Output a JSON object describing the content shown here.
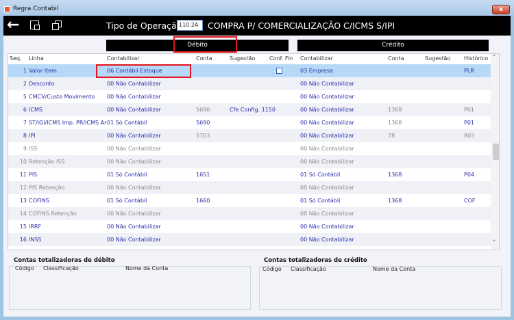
{
  "window": {
    "title": "Regra Contabil",
    "close_label": "x"
  },
  "toolbar": {
    "back_icon": "←",
    "icons": [
      "arrow-left-icon",
      "export-icon",
      "copy-window-icon"
    ],
    "tipo_label": "Tipo de Operação",
    "op_code": "110.2A",
    "op_description": "COMPRA P/ COMERCIALIZAÇÃO C/ICMS S/IPI"
  },
  "sections": {
    "debito": "Débito",
    "credito": "Crédito"
  },
  "columns": {
    "seq": "Seq.",
    "linha": "Linha",
    "contabilizar": "Contabilizar",
    "conta": "Conta",
    "sugestao": "Sugestão",
    "conf_fin": "Conf. Fin",
    "c_contabilizar": "Contabilizar",
    "c_conta": "Conta",
    "c_sugestao": "Sugestão",
    "historico": "Histórico"
  },
  "rows": [
    {
      "seq": "1",
      "linha": "Valor Item",
      "contab": "06 Contábil Estoque",
      "conta": "",
      "sug": "",
      "conf": true,
      "ccontab": "03 Empresa",
      "cconta": "",
      "csug": "",
      "hist": "PLR",
      "active": true
    },
    {
      "seq": "2",
      "linha": "Desconto",
      "contab": "00 Não Contabilizar",
      "conta": "",
      "sug": "",
      "conf": false,
      "ccontab": "00 Não Contabilizar",
      "cconta": "",
      "csug": "",
      "hist": "",
      "active": true
    },
    {
      "seq": "5",
      "linha": "CMCV/Custo Movimento",
      "contab": "00 Não Contabilizar",
      "conta": "",
      "sug": "",
      "conf": false,
      "ccontab": "00 Não Contabilizar",
      "cconta": "",
      "csug": "",
      "hist": "",
      "active": true
    },
    {
      "seq": "6",
      "linha": "ICMS",
      "contab": "00 Não Contabilizar",
      "conta": "5690",
      "sug": "Cfe Config. 1150",
      "conf": false,
      "ccontab": "00 Não Contabilizar",
      "cconta": "1368",
      "csug": "",
      "hist": "P01",
      "active": true,
      "grey": [
        "conta",
        "cconta",
        "hist"
      ]
    },
    {
      "seq": "7",
      "linha": "ST/IGI/ICMS Imp. PR/ICMS Ar",
      "contab": "01 Só Contábil",
      "conta": "5690",
      "sug": "",
      "conf": false,
      "ccontab": "00 Não Contabilizar",
      "cconta": "1368",
      "csug": "",
      "hist": "P01",
      "active": true,
      "grey": [
        "cconta"
      ]
    },
    {
      "seq": "8",
      "linha": "IPI",
      "contab": "00 Não Contabilizar",
      "conta": "5703",
      "sug": "",
      "conf": false,
      "ccontab": "00 Não Contabilizar",
      "cconta": "78",
      "csug": "",
      "hist": "803",
      "active": true,
      "grey": [
        "conta",
        "cconta",
        "hist"
      ]
    },
    {
      "seq": "9",
      "linha": "ISS",
      "contab": "00 Não Contabilizar",
      "conta": "",
      "sug": "",
      "conf": false,
      "ccontab": "00 Não Contabilizar",
      "cconta": "",
      "csug": "",
      "hist": "",
      "active": false
    },
    {
      "seq": "10",
      "linha": "Retenção ISS",
      "contab": "00 Não Contabilizar",
      "conta": "",
      "sug": "",
      "conf": false,
      "ccontab": "00 Não Contabilizar",
      "cconta": "",
      "csug": "",
      "hist": "",
      "active": false
    },
    {
      "seq": "11",
      "linha": "PIS",
      "contab": "01 Só Contábil",
      "conta": "1651",
      "sug": "",
      "conf": false,
      "ccontab": "01 Só Contábil",
      "cconta": "1368",
      "csug": "",
      "hist": "P04",
      "active": true
    },
    {
      "seq": "12",
      "linha": "PIS Retenção",
      "contab": "00 Não Contabilizar",
      "conta": "",
      "sug": "",
      "conf": false,
      "ccontab": "00 Não Contabilizar",
      "cconta": "",
      "csug": "",
      "hist": "",
      "active": false
    },
    {
      "seq": "13",
      "linha": "COFINS",
      "contab": "01 Só Contábil",
      "conta": "1660",
      "sug": "",
      "conf": false,
      "ccontab": "01 Só Contábil",
      "cconta": "1368",
      "csug": "",
      "hist": "COF",
      "active": true
    },
    {
      "seq": "14",
      "linha": "COFINS Retenção",
      "contab": "00 Não Contabilizar",
      "conta": "",
      "sug": "",
      "conf": false,
      "ccontab": "00 Não Contabilizar",
      "cconta": "",
      "csug": "",
      "hist": "",
      "active": false
    },
    {
      "seq": "15",
      "linha": "IRRF",
      "contab": "00 Não Contabilizar",
      "conta": "",
      "sug": "",
      "conf": false,
      "ccontab": "00 Não Contabilizar",
      "cconta": "",
      "csug": "",
      "hist": "",
      "active": true
    },
    {
      "seq": "16",
      "linha": "INSS",
      "contab": "00 Não Contabilizar",
      "conta": "",
      "sug": "",
      "conf": false,
      "ccontab": "00 Não Contabilizar",
      "cconta": "",
      "csug": "",
      "hist": "",
      "active": true
    }
  ],
  "totalizadoras": {
    "debito": {
      "title": "Contas totalizadoras de débito",
      "codigo": "Código",
      "classificacao": "Classificação",
      "nome": "Nome da Conta"
    },
    "credito": {
      "title": "Contas totalizadoras de crédito",
      "codigo": "Código",
      "classificacao": "Classificação",
      "nome": "Nome da Conta"
    }
  },
  "scroll": {
    "up": "˄",
    "down": "˅"
  },
  "colors": {
    "active_text": "#2a2aa8",
    "inactive_text": "#888888",
    "selected_row": "#b6d9f7",
    "highlight": "#e3131b"
  }
}
